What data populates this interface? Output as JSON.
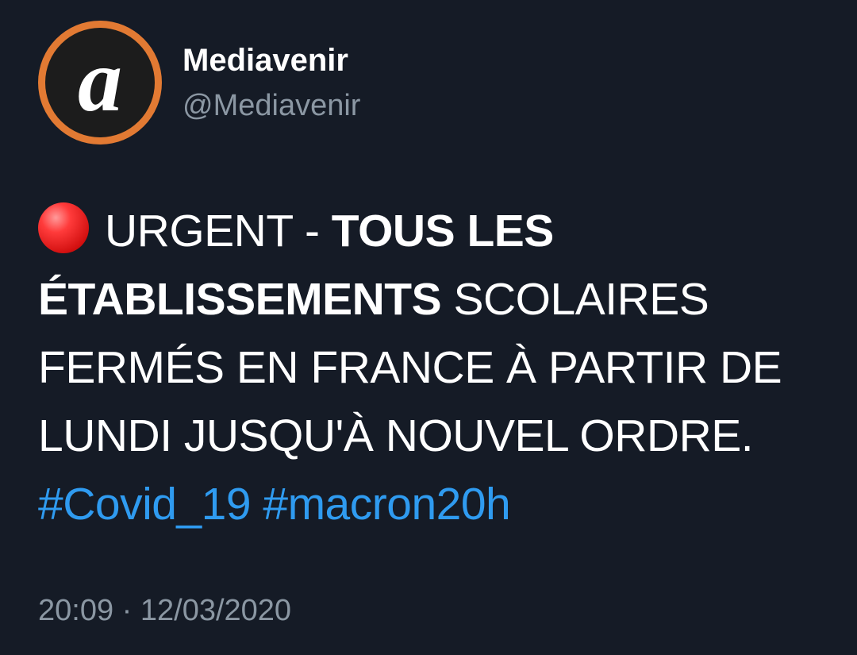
{
  "author": {
    "display_name": "Mediavenir",
    "handle": "@Mediavenir",
    "avatar_letter": "a",
    "avatar_ring_color": "#e27a33"
  },
  "tweet": {
    "emoji": "red-circle-icon",
    "line1_prefix": "URGENT - ",
    "line1_bold": "TOUS LES",
    "line2_bold": "ÉTABLISSEMENTS",
    "line2_rest": " SCOLAIRES",
    "line3": "FERMÉS EN FRANCE À PARTIR DE",
    "line4": "LUNDI JUSQU'À NOUVEL ORDRE.",
    "hashtags": [
      "#Covid_19",
      "#macron20h"
    ],
    "hashtag_color": "#2f9bf0"
  },
  "meta": {
    "timestamp": "20:09 · 12/03/2020"
  }
}
